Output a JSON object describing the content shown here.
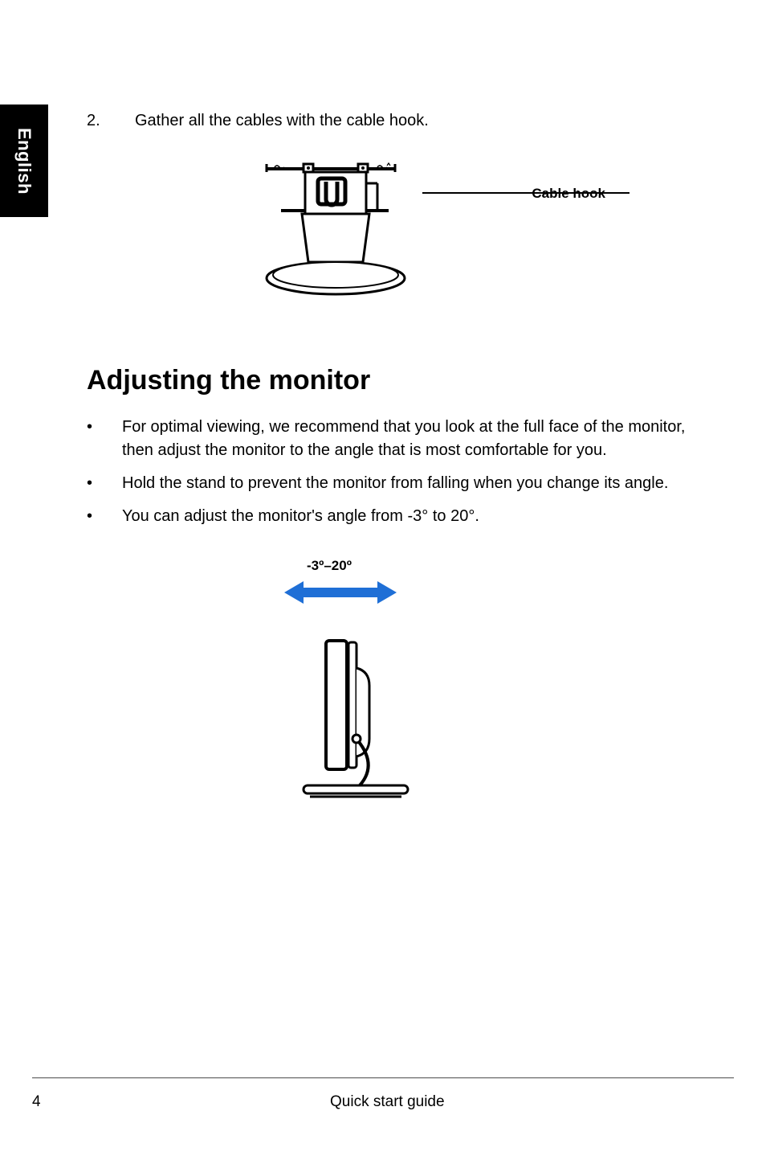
{
  "language_tab": "English",
  "step": {
    "number": "2.",
    "text": "Gather all the cables with the cable hook."
  },
  "figure1": {
    "label": "Cable hook"
  },
  "heading": "Adjusting the monitor",
  "bullets": [
    "For optimal viewing, we recommend that you look at the full face of the monitor, then adjust the monitor to the angle that is most comfortable for you.",
    "Hold the stand to prevent the monitor from falling when you change its angle.",
    "You can adjust the monitor's angle from -3° to 20°."
  ],
  "figure2": {
    "range_label": "-3º–20º"
  },
  "footer": {
    "page_number": "4",
    "title": "Quick start guide"
  }
}
